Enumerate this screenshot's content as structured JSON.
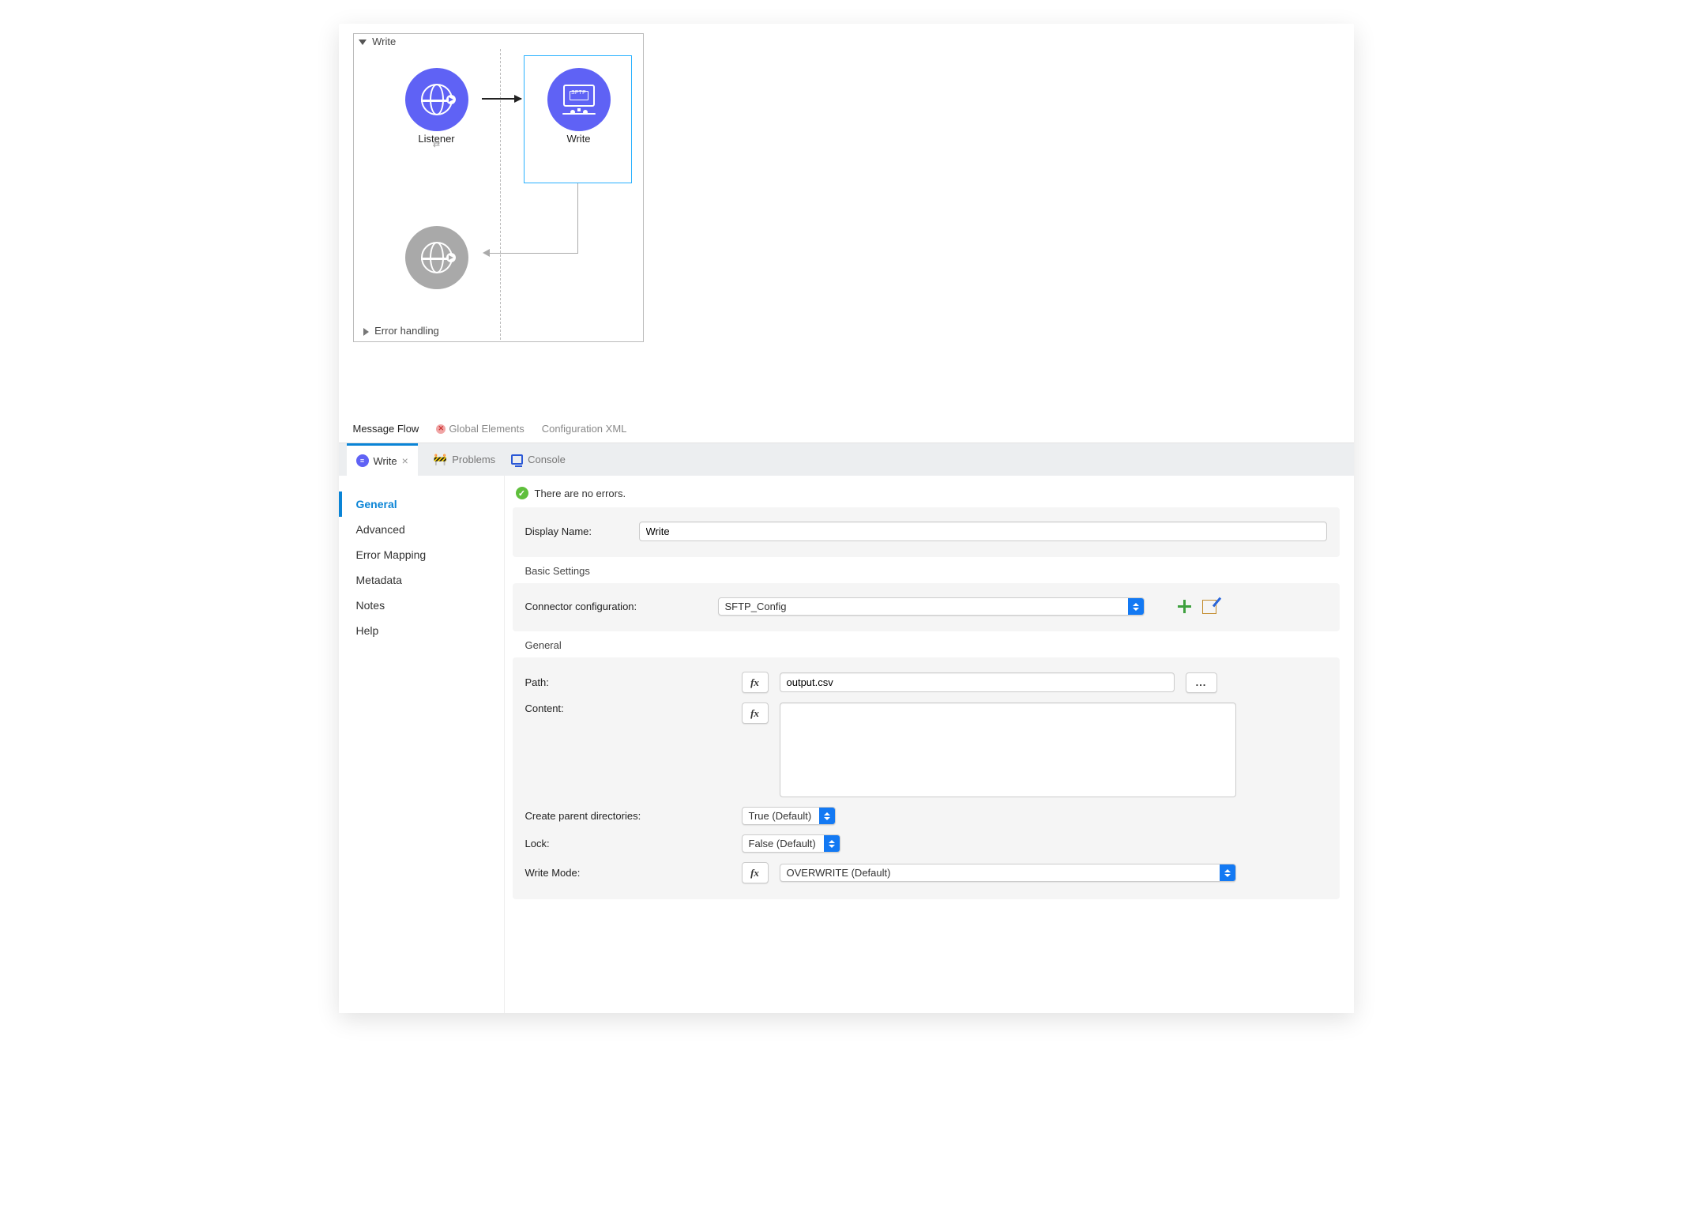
{
  "flow": {
    "title": "Write",
    "nodes": {
      "listener": "Listener",
      "write": "Write"
    },
    "error_section": "Error handling",
    "sftp_abbrev": "SFTP"
  },
  "sub_tabs": {
    "message_flow": "Message Flow",
    "global_elements": "Global Elements",
    "config_xml": "Configuration XML"
  },
  "bottom_tabs": {
    "write": "Write",
    "problems": "Problems",
    "console": "Console"
  },
  "side_nav": {
    "general": "General",
    "advanced": "Advanced",
    "error_mapping": "Error Mapping",
    "metadata": "Metadata",
    "notes": "Notes",
    "help": "Help"
  },
  "status": {
    "no_errors": "There are no errors."
  },
  "display": {
    "label": "Display Name:",
    "value": "Write"
  },
  "basic": {
    "title": "Basic Settings",
    "connector_label": "Connector configuration:",
    "connector_value": "SFTP_Config"
  },
  "general": {
    "title": "General",
    "path_label": "Path:",
    "path_value": "output.csv",
    "content_label": "Content:",
    "content_value": "",
    "cpd_label": "Create parent directories:",
    "cpd_value": "True (Default)",
    "lock_label": "Lock:",
    "lock_value": "False (Default)",
    "wm_label": "Write Mode:",
    "wm_value": "OVERWRITE (Default)",
    "ellipsis": "..."
  }
}
